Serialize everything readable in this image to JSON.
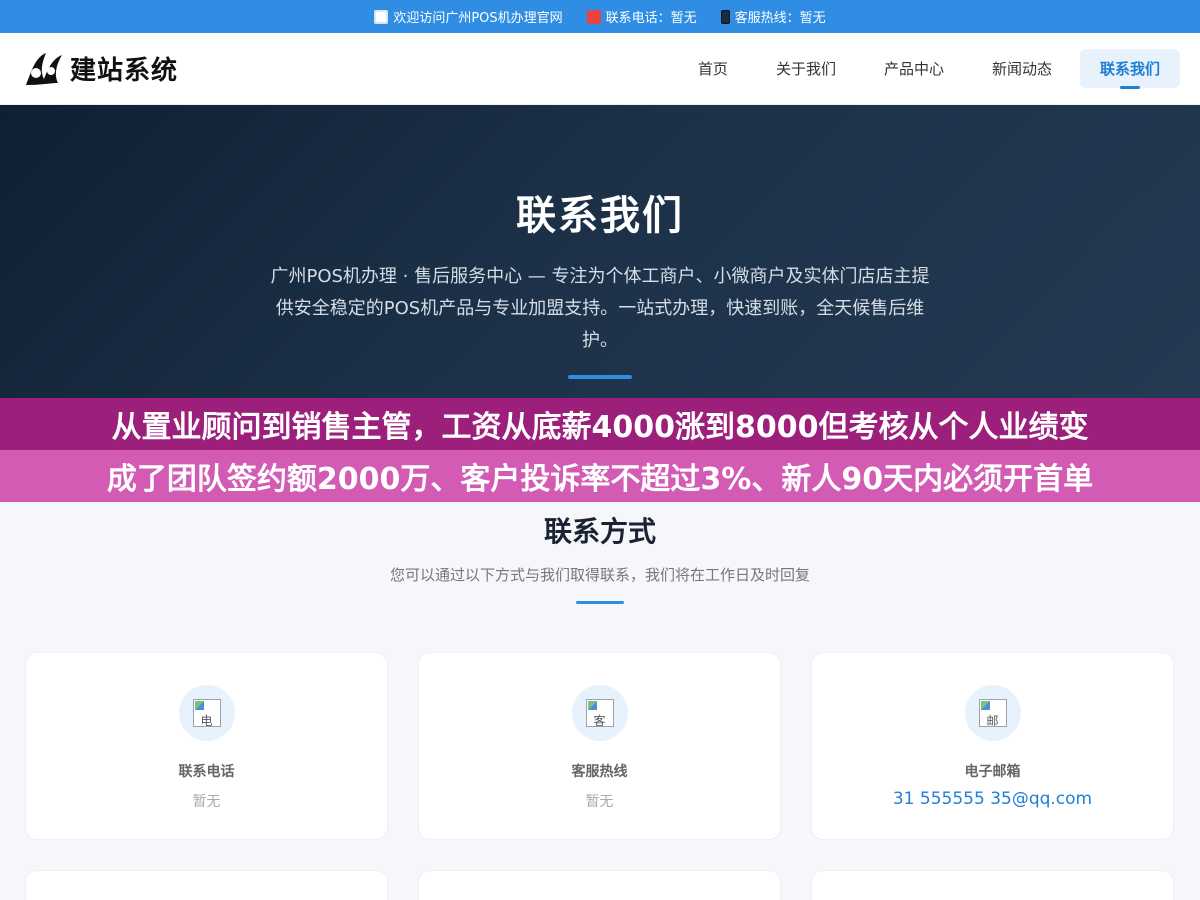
{
  "topbar": {
    "welcome": "欢迎访问广州POS机办理官网",
    "phone": "联系电话：暂无",
    "hotline": "客服热线：暂无"
  },
  "header": {
    "logo_text": "建站系统",
    "nav": [
      {
        "label": "首页"
      },
      {
        "label": "关于我们"
      },
      {
        "label": "产品中心"
      },
      {
        "label": "新闻动态"
      },
      {
        "label": "联系我们"
      }
    ]
  },
  "hero": {
    "title": "联系我们",
    "description": "广州POS机办理 · 售后服务中心 — 专注为个体工商户、小微商户及实体门店店主提供安全稳定的POS机产品与专业加盟支持。一站式办理，快速到账，全天候售后维护。"
  },
  "banner": {
    "line1": "从置业顾问到销售主管，工资从底薪4000涨到8000但考核从个人业绩变",
    "line2": "成了团队签约额2000万、客户投诉率不超过3%、新人90天内必须开首单"
  },
  "section": {
    "title": "联系方式",
    "subtitle": "您可以通过以下方式与我们取得联系，我们将在工作日及时回复"
  },
  "cards": [
    {
      "icon_alt": "电",
      "label": "联系电话",
      "value": "暂无"
    },
    {
      "icon_alt": "客",
      "label": "客服热线",
      "value": "暂无"
    },
    {
      "icon_alt": "邮",
      "label": "电子邮箱",
      "value": "31 555555 35@qq.com"
    }
  ],
  "colors": {
    "accent": "#2f8ee4",
    "link": "#1f7fd6",
    "banner_dark": "#9c1f7c",
    "banner_light": "#d35bb4"
  }
}
